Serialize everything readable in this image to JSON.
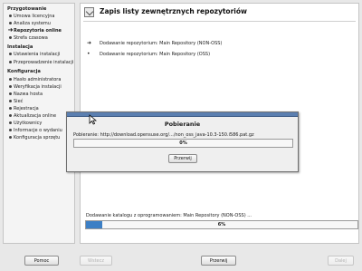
{
  "sidebar": {
    "sections": [
      {
        "title": "Przygotowanie",
        "items": [
          {
            "label": "Umowa licencyjna",
            "state": "done"
          },
          {
            "label": "Analiza systemu",
            "state": "done"
          },
          {
            "label": "Repozytoria online",
            "state": "active"
          },
          {
            "label": "Strefa czasowa",
            "state": "todo"
          }
        ]
      },
      {
        "title": "Instalacja",
        "items": [
          {
            "label": "Ustawienia instalacji",
            "state": "todo"
          },
          {
            "label": "Przeprowadzenie instalacji",
            "state": "todo"
          }
        ]
      },
      {
        "title": "Konfiguracja",
        "items": [
          {
            "label": "Hasło administratora",
            "state": "todo"
          },
          {
            "label": "Weryfikacja instalacji",
            "state": "todo"
          },
          {
            "label": "Nazwa hosta",
            "state": "todo"
          },
          {
            "label": "Sieć",
            "state": "todo"
          },
          {
            "label": "Rejestracja",
            "state": "todo"
          },
          {
            "label": "Aktualizacja online",
            "state": "todo"
          },
          {
            "label": "Użytkownicy",
            "state": "todo"
          },
          {
            "label": "Informacje o wydaniu",
            "state": "todo"
          },
          {
            "label": "Konfiguracja sprzętu",
            "state": "todo"
          }
        ]
      }
    ]
  },
  "main": {
    "title": "Zapis listy zewnętrznych repozytoriów",
    "title_icon": "window-arrow-icon",
    "repositories": [
      {
        "label": "Dodawanie repozytorium: Main Repository (NON-OSS)",
        "icon": "arrow-right-icon"
      },
      {
        "label": "Dodawanie repozytorium: Main Repository (OSS)",
        "icon": "bullet-icon"
      }
    ],
    "catalog": {
      "label": "Dodawanie katalogu z oprogramowaniem: Main Repository (NON-OSS) ...",
      "percent_text": "6%",
      "progress": 6
    }
  },
  "dialog": {
    "title": "Pobieranie",
    "label": "Pobieranie: http://download.opensuse.org/.../non_oss_java-10.3-150.i586.pat.gz",
    "percent_text": "0%",
    "progress": 0,
    "cancel_label": "Przerwij"
  },
  "buttons": {
    "help": "Pomoc",
    "back": "Wstecz",
    "abort": "Przerwij",
    "next": "Dalej"
  },
  "colors": {
    "accent": "#3c7fc5",
    "dialog_titlebar": "#5b7fb0"
  }
}
